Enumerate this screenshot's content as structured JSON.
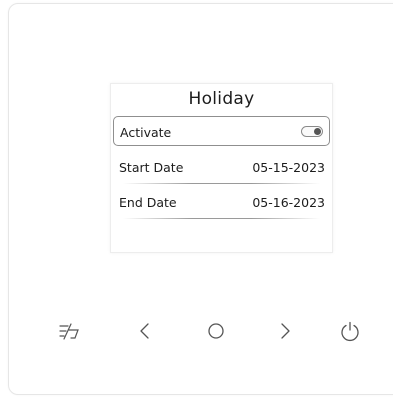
{
  "screen": {
    "title": "Holiday",
    "activate": {
      "label": "Activate",
      "toggle_state": "off"
    },
    "start_date": {
      "label": "Start Date",
      "value": "05-15-2023"
    },
    "end_date": {
      "label": "End Date",
      "value": "05-16-2023"
    }
  },
  "controls": {
    "icons": [
      "mode-icon",
      "chevron-left-icon",
      "circle-home-icon",
      "chevron-right-icon",
      "power-icon"
    ]
  },
  "colors": {
    "text": "#1c1c1c",
    "icon": "#555555",
    "outline": "#8f8f8f",
    "background": "#ffffff"
  }
}
